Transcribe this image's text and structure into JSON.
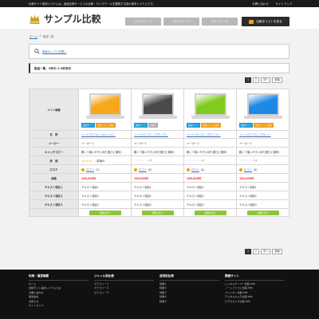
{
  "topbar": {
    "description": "比較サイト基本システムは、製品比較サービスの比較・ロングテールを獲得する為の基本システムです。",
    "links": [
      "お問い合わせ",
      "サイトマップ"
    ]
  },
  "header": {
    "logo_text": "サンプル比較",
    "categories": [
      "カテゴリー１",
      "カテゴリー２",
      "カテゴリー３"
    ],
    "list_button": "比較中リストを見る"
  },
  "breadcrumb": {
    "home": "ホーム",
    "separator": ">",
    "current": "製品一覧"
  },
  "search": {
    "label": "検索ボックスを開く"
  },
  "list_header": {
    "title": "製品一覧　5件中 1-4件表示"
  },
  "pager": {
    "pages": [
      "1",
      "2"
    ],
    "next": "次へ",
    "last": "最後"
  },
  "table": {
    "row_labels": {
      "image": "メイン画像",
      "name": "名　称",
      "maker": "メーカー",
      "catch": "キャッチコピー",
      "rating": "評　価",
      "review": "口コミ",
      "price": "価格",
      "text1": "テキスト項目１",
      "text2": "テキスト項目２",
      "text3": "テキスト項目３"
    },
    "products": [
      {
        "screen_color": "#f6a81a",
        "badges": [
          {
            "text": "製品サイト",
            "color": "blue"
          },
          {
            "text": "比較リストに追加",
            "color": "orange"
          }
        ],
        "name": "ノートパソコン（オレンジ）",
        "maker": "メーカー１",
        "catch": "軽くて使いやすい持ち運びに便利!",
        "stars": 4,
        "rating_text": "(評価4)",
        "review": "口コミ",
        "review_count": "(1)",
        "price": "150,000円",
        "text1": "テキスト項目1",
        "text2": "テキスト項目2",
        "text3": "テキスト項目3",
        "detail": "詳細を見る"
      },
      {
        "screen_color": "#4a4a4a",
        "badges": [
          {
            "text": "製品サイト",
            "color": "blue"
          },
          {
            "text": "比較中",
            "color": "grey"
          }
        ],
        "name": "ノートパソコン（ブラック）",
        "maker": "メーカー１",
        "catch": "軽くて使いやすい持ち運びに便利!",
        "stars": 0,
        "rating_text": "(-)",
        "review": "口コミ",
        "review_count": "(0)",
        "price": "150,000円",
        "text1": "テキスト項目1",
        "text2": "テキスト項目2",
        "text3": "テキスト項目3",
        "detail": "詳細を見る"
      },
      {
        "screen_color": "#7fcc1e",
        "badges": [
          {
            "text": "製品サイト",
            "color": "blue"
          },
          {
            "text": "比較リストに追加",
            "color": "orange"
          }
        ],
        "name": "ノートパソコン（グリーン）",
        "maker": "メーカー１",
        "catch": "軽くて使いやすい持ち運びに便利!",
        "stars": 0,
        "rating_text": "(-)",
        "review": "口コミ",
        "review_count": "(0)",
        "price": "150,000円",
        "text1": "テキスト項目1",
        "text2": "テキスト項目2",
        "text3": "テキスト項目3",
        "detail": "詳細を見る"
      },
      {
        "screen_color": "#1e88e5",
        "badges": [
          {
            "text": "製品サイト",
            "color": "blue"
          },
          {
            "text": "比較リストに追加",
            "color": "orange"
          }
        ],
        "name": "ノートパソコン（ブルー）",
        "maker": "メーカー１",
        "catch": "軽くて使いやすい持ち運びに便利!",
        "stars": 0,
        "rating_text": "(-)",
        "review": "口コミ",
        "review_count": "(0)",
        "price": "150,000円",
        "text1": "テキスト項目1",
        "text2": "テキスト項目2",
        "text3": "テキスト項目3",
        "detail": "詳細を見る"
      }
    ]
  },
  "footer": {
    "columns": [
      {
        "heading": "利用・運営概要",
        "items": [
          "ホーム",
          "比較サイト基本システムとは",
          "お問い合わせ",
          "運営会社",
          "お知らせ",
          "サイトマップ"
        ]
      },
      {
        "heading": "ジャンル別比較",
        "items": [
          "カテゴリー１",
          "カテゴリー２",
          "カテゴリー３"
        ]
      },
      {
        "heading": "目的別比較",
        "items": [
          "特徴１",
          "特徴２",
          "特徴３",
          "特徴４",
          "特徴５"
        ]
      },
      {
        "heading": "関連サイト",
        "items": [
          "レンタルサーバー比較.info",
          "ノートパソコン比較.info",
          "プリンター比較.info",
          "デジタルカメラ比較.info",
          "ビデオカメラ比較.info"
        ]
      }
    ]
  }
}
